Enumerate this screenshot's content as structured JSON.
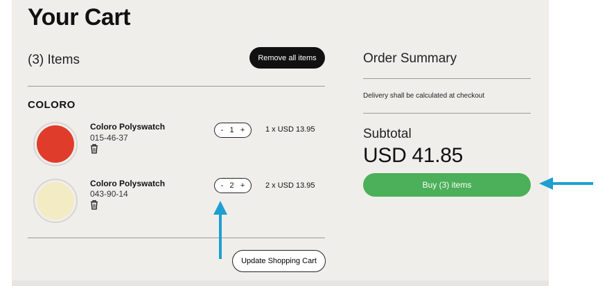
{
  "cart": {
    "title": "Your Cart",
    "items_count": "(3) Items",
    "remove_all_label": "Remove all items",
    "update_label": "Update Shopping Cart",
    "brand": "COLORO",
    "items": [
      {
        "name": "Coloro Polyswatch",
        "code": "015-46-37",
        "color": "#e03c2c",
        "quantity": "1",
        "price_line": "1 x USD 13.95"
      },
      {
        "name": "Coloro Polyswatch",
        "code": "043-90-14",
        "color": "#f2ebc4",
        "quantity": "2",
        "price_line": "2 x USD 13.95"
      }
    ],
    "stepper": {
      "minus": "-",
      "plus": "+"
    }
  },
  "summary": {
    "title": "Order Summary",
    "delivery_note": "Delivery shall be calculated at checkout",
    "subtotal_label": "Subtotal",
    "subtotal_value": "USD 41.85",
    "buy_label": "Buy (3) items"
  },
  "colors": {
    "panel_bg": "#f0eeea",
    "accent_green": "#4caf59",
    "annotation_arrow": "#1da0d1"
  }
}
